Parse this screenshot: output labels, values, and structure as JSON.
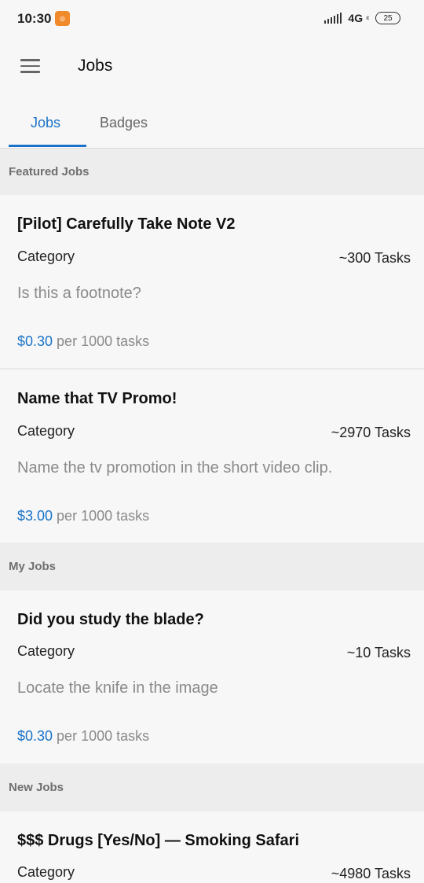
{
  "status_bar": {
    "time": "10:30",
    "network": "4G",
    "network_sub": "ıt",
    "battery": "25",
    "icons": [
      "notification-app-icon",
      "signal-icon",
      "battery-icon"
    ]
  },
  "app_bar": {
    "menu_icon": "hamburger-menu-icon",
    "title": "Jobs"
  },
  "tabs": [
    {
      "label": "Jobs",
      "active": true
    },
    {
      "label": "Badges",
      "active": false
    }
  ],
  "colors": {
    "accent": "#1a73c8",
    "muted_text": "#8a8a8a",
    "section_bg": "#ededed"
  },
  "sections": [
    {
      "title": "Featured Jobs",
      "jobs": [
        {
          "title": "[Pilot] Carefully Take Note V2",
          "category": "Category",
          "tasks": "~300 Tasks",
          "description": "Is this a footnote?",
          "price": "$0.30",
          "price_suffix": " per 1000 tasks"
        },
        {
          "title": "Name that TV Promo!",
          "category": "Category",
          "tasks": "~2970 Tasks",
          "description": "Name the tv promotion in the short video clip.",
          "price": "$3.00",
          "price_suffix": " per 1000 tasks"
        }
      ]
    },
    {
      "title": "My Jobs",
      "jobs": [
        {
          "title": "Did you study the blade?",
          "category": "Category",
          "tasks": "~10 Tasks",
          "description": "Locate the knife in the image",
          "price": "$0.30",
          "price_suffix": " per 1000 tasks"
        }
      ]
    },
    {
      "title": "New Jobs",
      "jobs": [
        {
          "title": "$$$ Drugs [Yes/No] — Smoking Safari",
          "category": "Category",
          "tasks": "~4980 Tasks"
        }
      ]
    }
  ]
}
